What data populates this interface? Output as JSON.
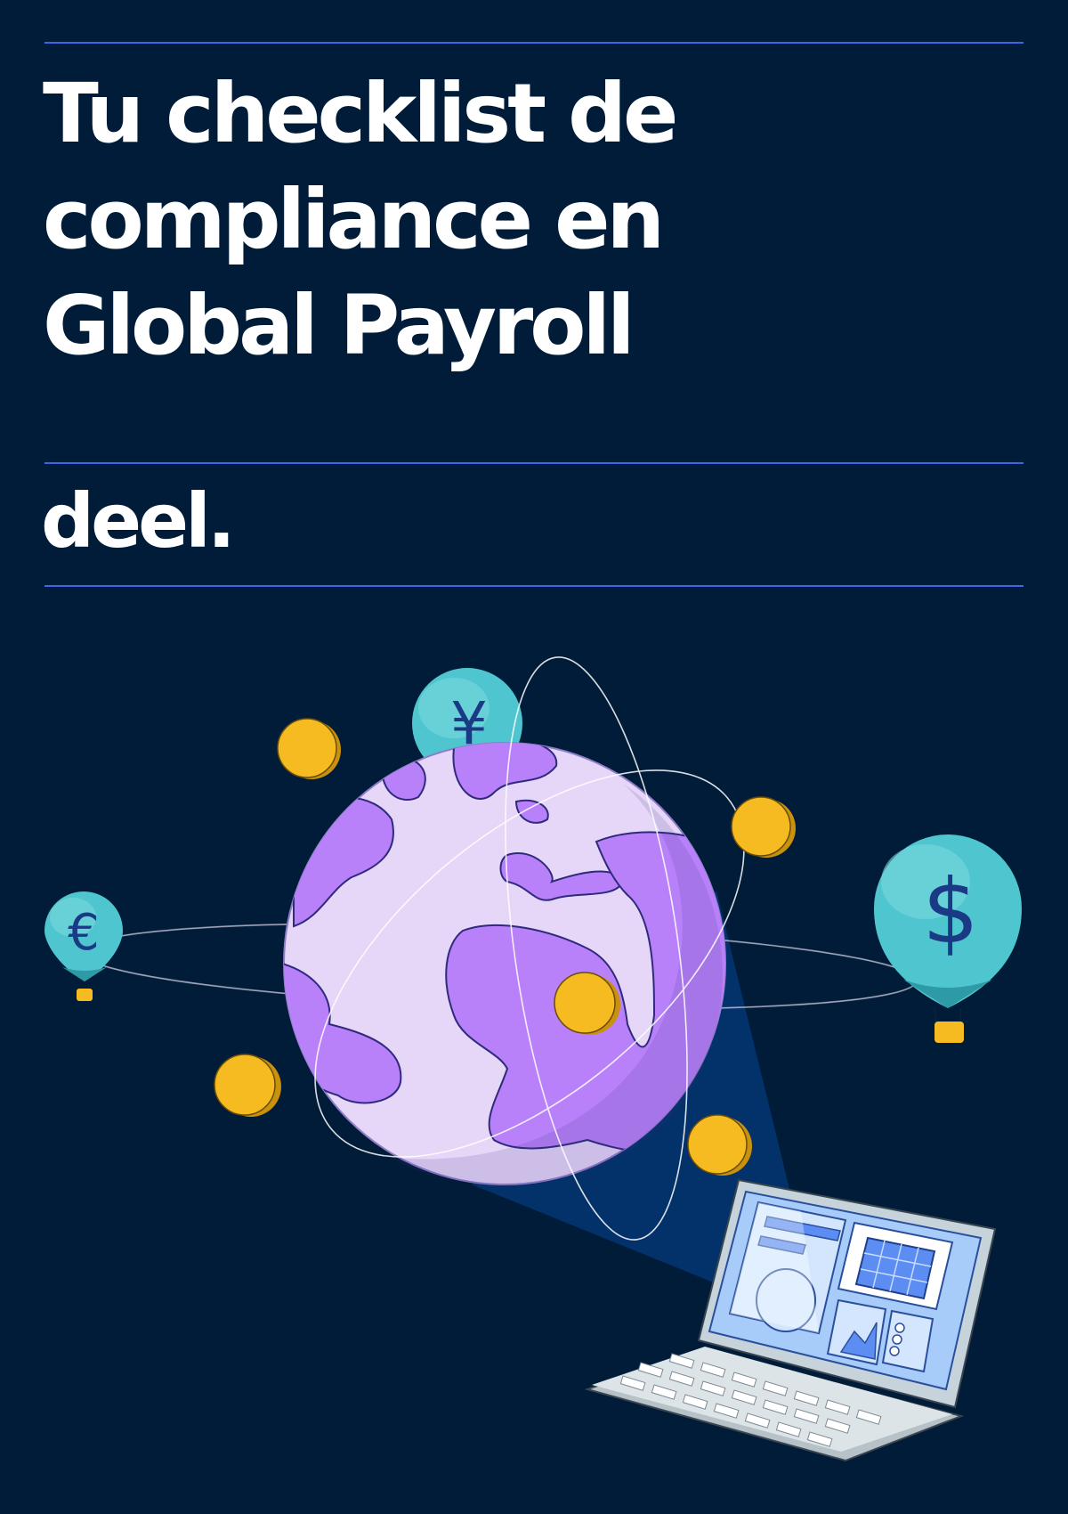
{
  "cover": {
    "title_lines": [
      "Tu checklist de",
      "compliance en",
      "Global Payroll"
    ],
    "brand": "deel."
  },
  "illustration": {
    "currency_symbols": {
      "yen": "¥",
      "euro": "€",
      "dollar": "$"
    },
    "icons": [
      "globe-icon",
      "coin-icon",
      "hot-air-balloon-icon",
      "laptop-icon"
    ]
  },
  "colors": {
    "background": "#001c38",
    "rule": "#3f66e6",
    "text": "#ffffff",
    "globe_light": "#e6d6f8",
    "globe_land": "#b881f9",
    "coin": "#f6bb21",
    "balloon": "#4fc6cf",
    "laptop_screen": "#a8ccfa"
  }
}
